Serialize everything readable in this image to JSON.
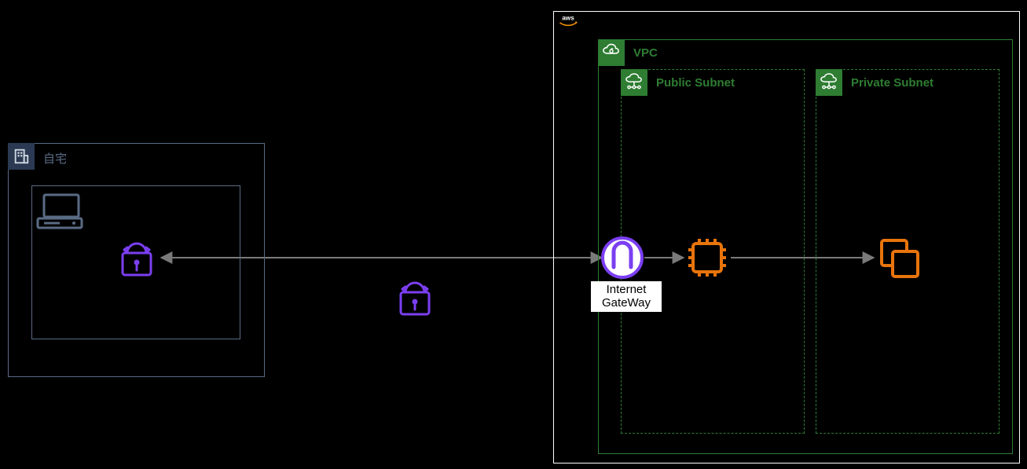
{
  "aws": {
    "label": "aws"
  },
  "home": {
    "label": "自宅"
  },
  "vpc": {
    "label": "VPC"
  },
  "public": {
    "label": "Public Subnet"
  },
  "private": {
    "label": "Private Subnet"
  },
  "igw": {
    "label": "Internet\nGateWay"
  },
  "colors": {
    "purple": "#7b3ff2",
    "orange": "#e8740c",
    "green": "#2e7d32",
    "slate": "#5a6b84",
    "arrow": "#7a7a7a"
  }
}
